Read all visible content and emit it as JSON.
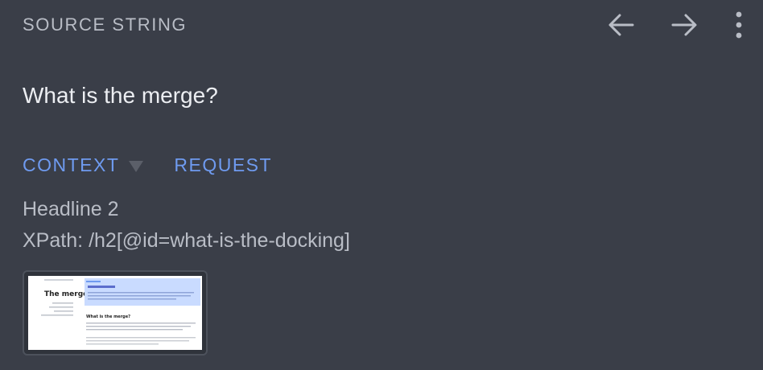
{
  "header": {
    "title": "SOURCE STRING",
    "prev_icon": "arrow-left-icon",
    "next_icon": "arrow-right-icon",
    "more_icon": "more-vertical-icon"
  },
  "source": {
    "text": "What is the merge?"
  },
  "tabs": [
    {
      "label": "CONTEXT",
      "has_dropdown": true
    },
    {
      "label": "REQUEST",
      "has_dropdown": false
    }
  ],
  "context": {
    "type_label": "Headline 2",
    "xpath_label": "XPath:",
    "xpath_value": "/h2[@id=what-is-the-docking]"
  },
  "screenshot_preview": {
    "page_title": "The merge",
    "section_heading": "What is the merge?"
  },
  "colors": {
    "background": "#3a3e48",
    "accent": "#6f9bf0",
    "muted_text": "#b9bdc6",
    "primary_text": "#eceef2"
  }
}
